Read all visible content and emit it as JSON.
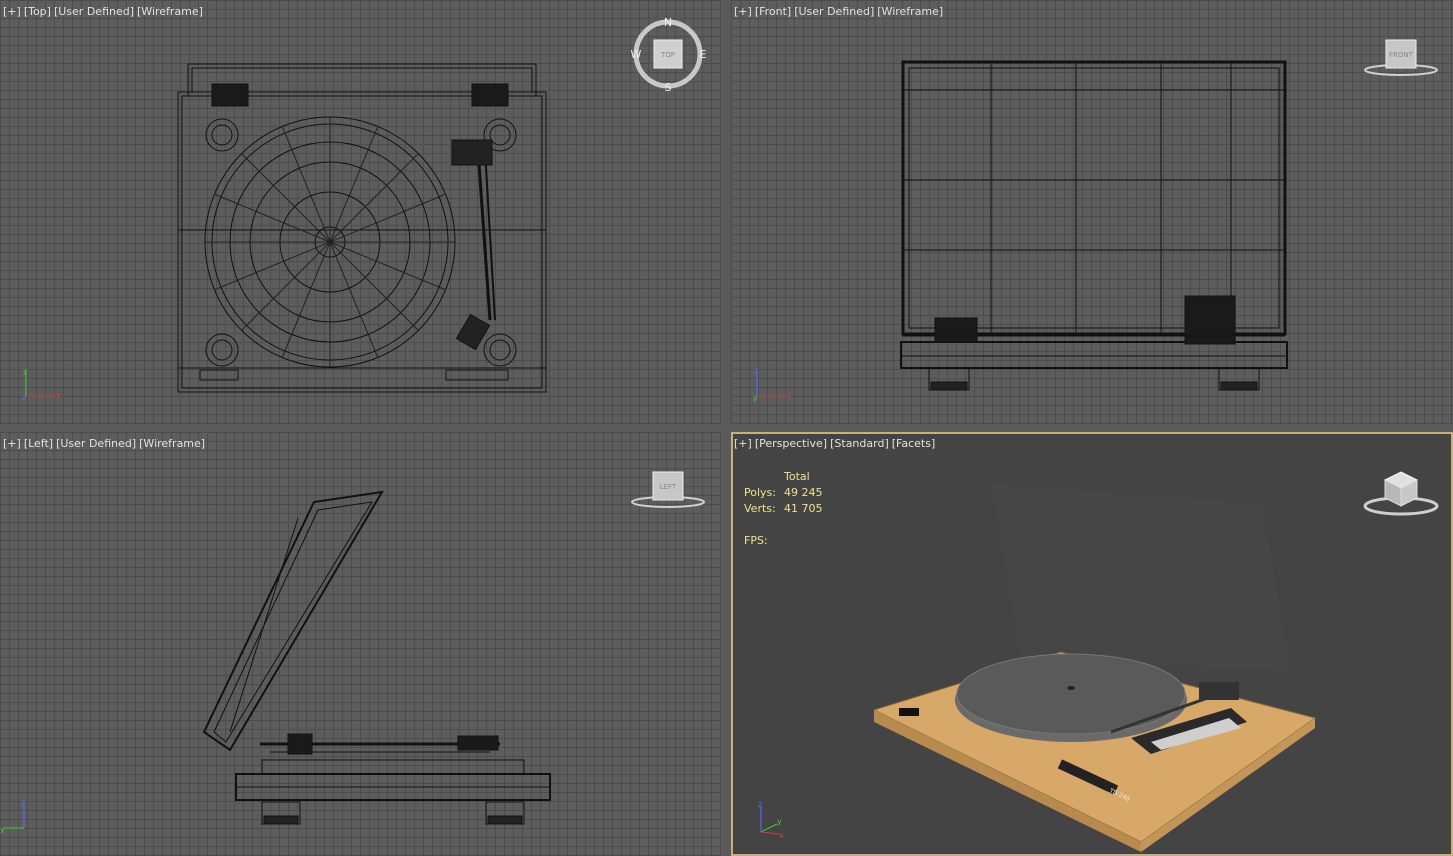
{
  "viewports": {
    "top": {
      "labels": [
        "[+]",
        "[Top]",
        "[User Defined]",
        "[Wireframe]"
      ],
      "cube": "TOP",
      "compass": {
        "n": "N",
        "s": "S",
        "e": "E",
        "w": "W"
      }
    },
    "front": {
      "labels": [
        "[+]",
        "[Front]",
        "[User Defined]",
        "[Wireframe]"
      ],
      "cube": "FRONT"
    },
    "left": {
      "labels": [
        "[+]",
        "[Left]",
        "[User Defined]",
        "[Wireframe]"
      ],
      "cube": "LEFT"
    },
    "perspective": {
      "labels": [
        "[+]",
        "[Perspective]",
        "[Standard]",
        "[Facets]"
      ]
    }
  },
  "stats": {
    "header": "Total",
    "polys_label": "Polys:",
    "polys_value": "49 245",
    "verts_label": "Verts:",
    "verts_value": "41 705",
    "fps_label": "FPS:"
  },
  "axes": {
    "x": "x",
    "y": "y",
    "z": "z"
  },
  "colors": {
    "active_border": "#c8b07a",
    "stats_text": "#f2e28a",
    "wood": "#d9a86a",
    "platter": "#5a5a5a"
  },
  "model": {
    "brand_label": "TD 240"
  }
}
